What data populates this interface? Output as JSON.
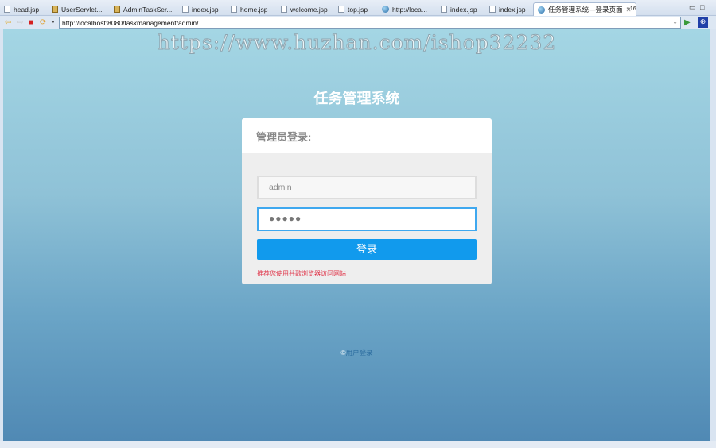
{
  "tabs": [
    {
      "label": "head.jsp",
      "icon": "file"
    },
    {
      "label": "UserServlet...",
      "icon": "java"
    },
    {
      "label": "AdminTaskSer...",
      "icon": "java"
    },
    {
      "label": "index.jsp",
      "icon": "file"
    },
    {
      "label": "home.jsp",
      "icon": "file"
    },
    {
      "label": "welcome.jsp",
      "icon": "file"
    },
    {
      "label": "top.jsp",
      "icon": "file"
    },
    {
      "label": "http://loca...",
      "icon": "globe"
    },
    {
      "label": "index.jsp",
      "icon": "file"
    },
    {
      "label": "index.jsp",
      "icon": "file"
    },
    {
      "label": "任务管理系统—登录页面",
      "icon": "globe",
      "active": true
    }
  ],
  "overflow_tabs": "»16",
  "address": "http://localhost:8080/taskmanagement/admin/",
  "watermark": "https://www.huzhan.com/ishop32232",
  "page": {
    "title": "任务管理系统",
    "card_title": "管理员登录:",
    "username_value": "admin",
    "password_value": "●●●●●",
    "login_button": "登录",
    "hint": "推荐您使用谷歌浏览器访问网站",
    "footer_symbol": "©",
    "footer_link": "用户登录"
  },
  "colors": {
    "accent": "#119aed",
    "hint": "#e0364a"
  }
}
